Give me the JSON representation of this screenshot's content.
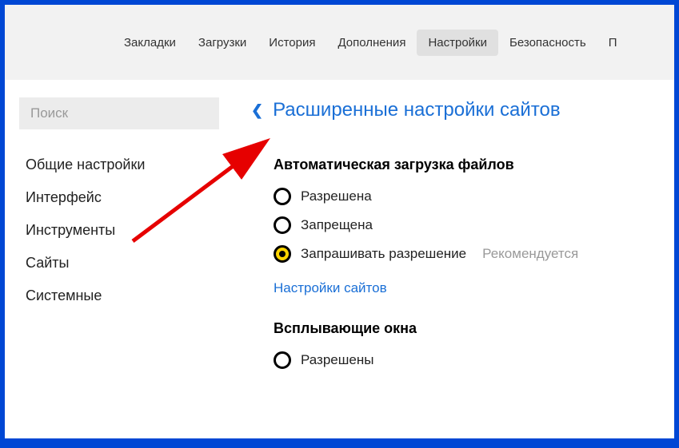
{
  "topbar": {
    "tabs": [
      {
        "label": "Закладки",
        "active": false
      },
      {
        "label": "Загрузки",
        "active": false
      },
      {
        "label": "История",
        "active": false
      },
      {
        "label": "Дополнения",
        "active": false
      },
      {
        "label": "Настройки",
        "active": true
      },
      {
        "label": "Безопасность",
        "active": false
      },
      {
        "label": "П",
        "active": false
      }
    ]
  },
  "sidebar": {
    "search_placeholder": "Поиск",
    "items": [
      {
        "label": "Общие настройки"
      },
      {
        "label": "Интерфейс"
      },
      {
        "label": "Инструменты"
      },
      {
        "label": "Сайты"
      },
      {
        "label": "Системные"
      }
    ]
  },
  "main": {
    "title": "Расширенные настройки сайтов",
    "sections": [
      {
        "title": "Автоматическая загрузка файлов",
        "options": [
          {
            "label": "Разрешена",
            "selected": false
          },
          {
            "label": "Запрещена",
            "selected": false
          },
          {
            "label": "Запрашивать разрешение",
            "selected": true,
            "recommended": "Рекомендуется"
          }
        ],
        "link": "Настройки сайтов"
      },
      {
        "title": "Всплывающие окна",
        "options": [
          {
            "label": "Разрешены",
            "selected": false
          }
        ]
      }
    ]
  }
}
